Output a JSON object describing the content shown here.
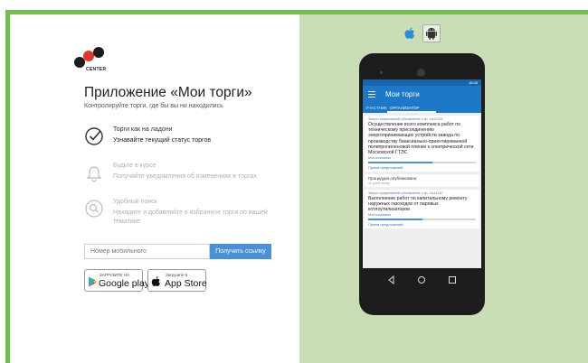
{
  "logo": {
    "text": "CENTER",
    "digit": "2"
  },
  "promo": {
    "title": "Приложение «Мои торги»",
    "subtitle": "Контролируйте торги, где бы вы ни находились"
  },
  "features": [
    {
      "icon": "check-circle-icon",
      "title": "Торги как на ладони",
      "text": "Узнавайте текущий статус торгов"
    },
    {
      "icon": "bell-icon",
      "title": "Будьте в курсе",
      "text": "Получайте уведомления об изменениях в торгах"
    },
    {
      "icon": "search-icon",
      "title": "Удобный поиск",
      "text": "Находите и добавляйте в избранное торги по вашей тематике"
    }
  ],
  "form": {
    "phone_placeholder": "Номер мобильного",
    "button_label": "Получить ссылку"
  },
  "stores": {
    "google_small": "ЗАГРУЗИТЕ НА",
    "google_big": "Google play",
    "apple_small": "Загрузите в",
    "apple_big": "App Store"
  },
  "platforms": [
    "apple-icon",
    "android-icon"
  ],
  "phone": {
    "status_time": "18:48",
    "app_title": "Мои торги",
    "tabs": [
      "УЧАСТНИК",
      "ОРГАНИЗАТОР"
    ],
    "cards": [
      {
        "meta": "Запрос предложений (объявление о пр...№41209",
        "body": "Осуществление всего комплекса работ по техническому присоединению энергопринимающих устройств завода по производству биаксиально-ориентированной полипропиленовой пленки к электрической сети Московской ГТЭС",
        "org": "Моя компания",
        "progress": 0.6,
        "action": "Прием предложений"
      }
    ],
    "procedure": {
      "title": "Процедура опубликована",
      "time": "11 дней назад"
    },
    "cards2": [
      {
        "meta": "Запрос предложений (объявление о пр...№41240",
        "body": "Выполнение работ по капитальному ремонту наружных газоходов от паровых котлоутилизаторов",
        "org": "Моя компания",
        "progress": 0.5,
        "action": "Прием предложений"
      }
    ]
  },
  "colors": {
    "accent_green": "#6fbf4a",
    "panel_green": "#c9deb6",
    "button_blue": "#4a90d9",
    "app_blue": "#1e78c8",
    "logo_red": "#e0362c"
  }
}
